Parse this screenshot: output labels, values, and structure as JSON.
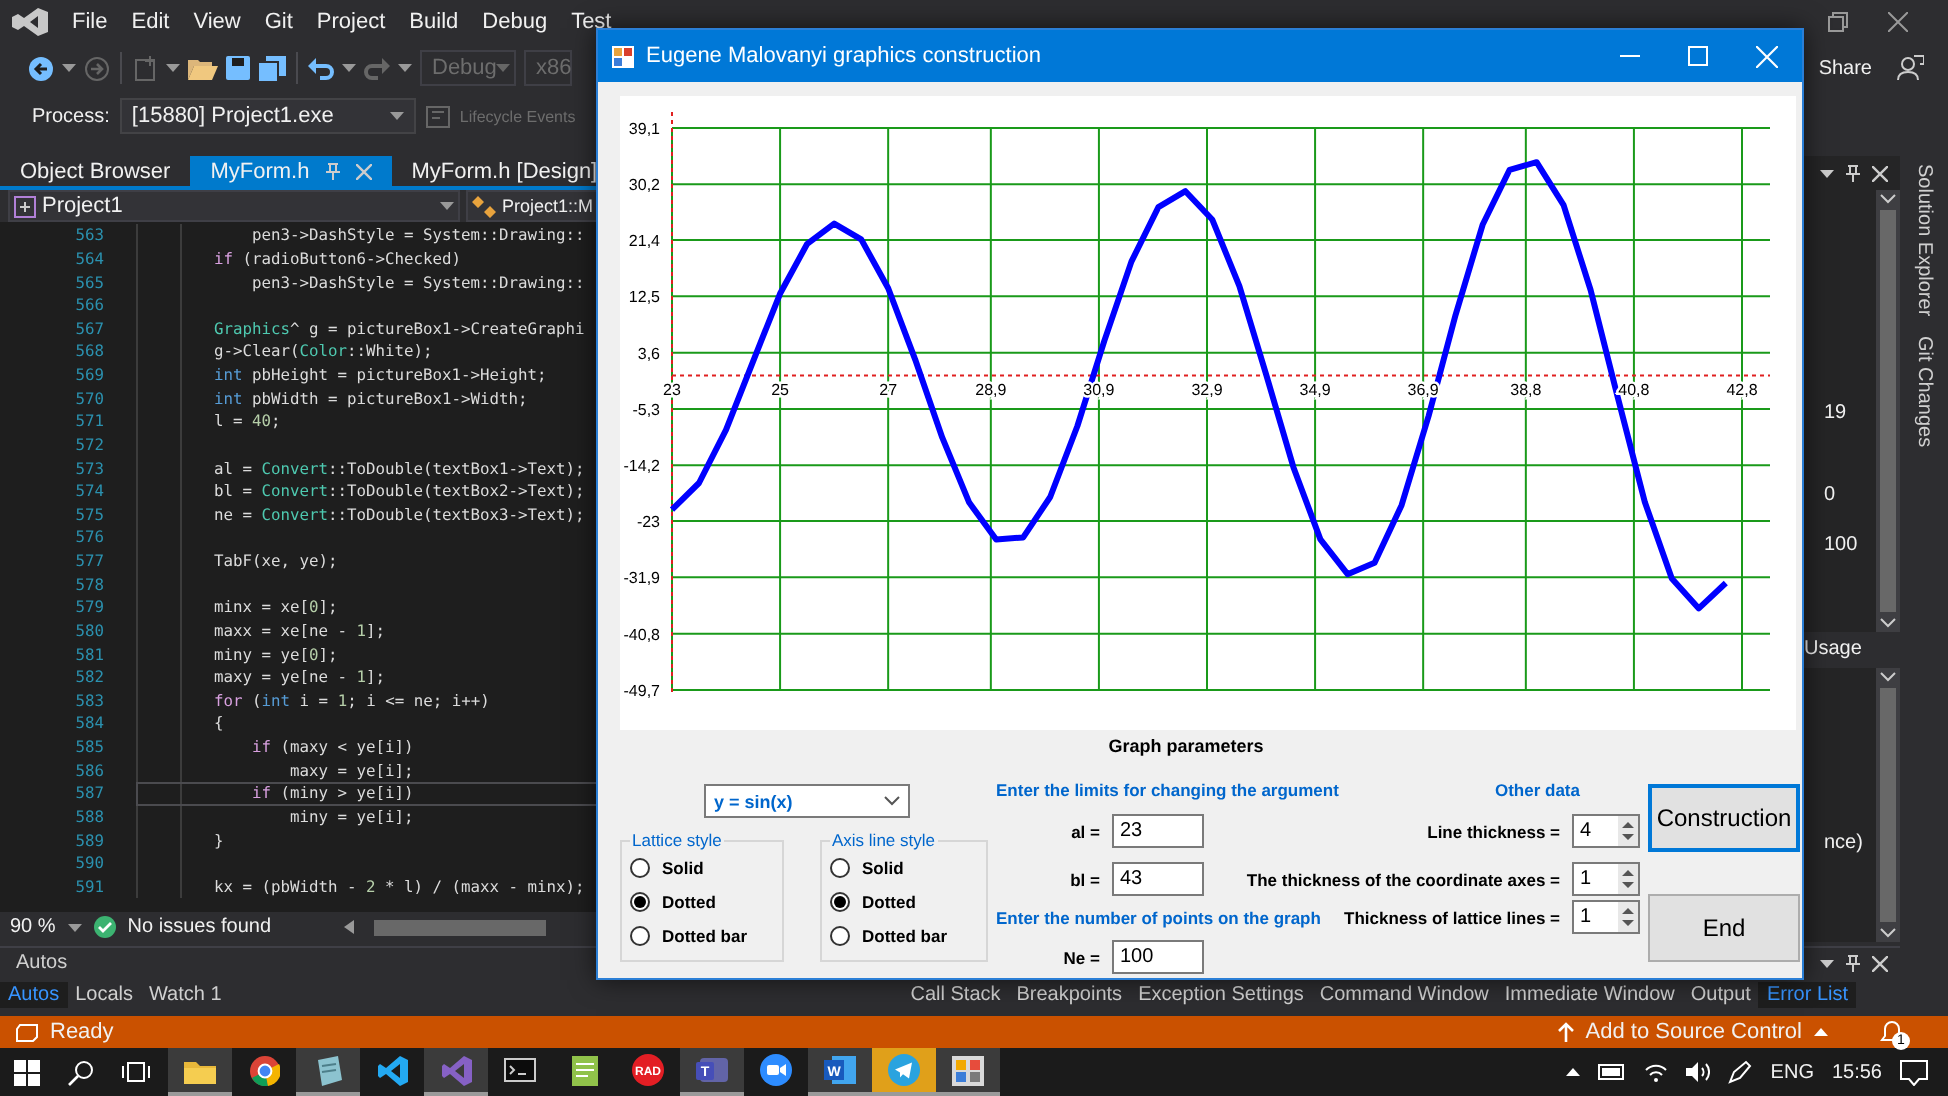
{
  "ide": {
    "menu": [
      "File",
      "Edit",
      "View",
      "Git",
      "Project",
      "Build",
      "Debug",
      "Test"
    ],
    "toolbar": {
      "configuration": "Debug",
      "platform": "x86",
      "share": "Share"
    },
    "process": {
      "label": "Process:",
      "value": "[15880] Project1.exe",
      "events": "Lifecycle Events"
    },
    "tabs": [
      {
        "label": "Object Browser",
        "selected": false
      },
      {
        "label": "MyForm.h",
        "selected": true
      },
      {
        "label": "MyForm.h [Design]",
        "selected": false
      }
    ],
    "navigation": {
      "project": "Project1",
      "scope": "Project1::M"
    },
    "editor": {
      "lines": [
        {
          "number": "563",
          "current": false,
          "code": [
            {
              "kind": "plain",
              "text": "    pen3->DashStyle = System::Drawing::"
            }
          ]
        },
        {
          "number": "564",
          "current": false,
          "code": [
            {
              "kind": "keyword",
              "text": "if"
            },
            {
              "kind": "plain",
              "text": " (radioButton6->Checked)"
            }
          ]
        },
        {
          "number": "565",
          "current": false,
          "code": [
            {
              "kind": "plain",
              "text": "    pen3->DashStyle = System::Drawing::"
            }
          ]
        },
        {
          "number": "566",
          "current": false
        },
        {
          "number": "567",
          "current": false,
          "code": [
            {
              "kind": "class",
              "text": "Graphics"
            },
            {
              "kind": "plain",
              "text": "^ g = pictureBox1->CreateGraphi"
            }
          ]
        },
        {
          "number": "568",
          "current": false,
          "code": [
            {
              "kind": "plain",
              "text": "g->Clear("
            },
            {
              "kind": "class",
              "text": "Color"
            },
            {
              "kind": "plain",
              "text": "::White);"
            }
          ]
        },
        {
          "number": "569",
          "current": false,
          "code": [
            {
              "kind": "type",
              "text": "int"
            },
            {
              "kind": "plain",
              "text": " pbHeight = pictureBox1->Height;"
            }
          ]
        },
        {
          "number": "570",
          "current": false,
          "code": [
            {
              "kind": "type",
              "text": "int"
            },
            {
              "kind": "plain",
              "text": " pbWidth = pictureBox1->Width;"
            }
          ]
        },
        {
          "number": "571",
          "current": false,
          "code": [
            {
              "kind": "plain",
              "text": "l = "
            },
            {
              "kind": "number",
              "text": "40"
            },
            {
              "kind": "plain",
              "text": ";"
            }
          ]
        },
        {
          "number": "572",
          "current": false
        },
        {
          "number": "573",
          "current": false,
          "code": [
            {
              "kind": "plain",
              "text": "al = "
            },
            {
              "kind": "class",
              "text": "Convert"
            },
            {
              "kind": "plain",
              "text": "::ToDouble(textBox1->Text);"
            }
          ]
        },
        {
          "number": "574",
          "current": false,
          "code": [
            {
              "kind": "plain",
              "text": "bl = "
            },
            {
              "kind": "class",
              "text": "Convert"
            },
            {
              "kind": "plain",
              "text": "::ToDouble(textBox2->Text);"
            }
          ]
        },
        {
          "number": "575",
          "current": false,
          "code": [
            {
              "kind": "plain",
              "text": "ne = "
            },
            {
              "kind": "class",
              "text": "Convert"
            },
            {
              "kind": "plain",
              "text": "::ToDouble(textBox3->Text);"
            }
          ]
        },
        {
          "number": "576",
          "current": false
        },
        {
          "number": "577",
          "current": false,
          "code": [
            {
              "kind": "plain",
              "text": "TabF(xe, ye);"
            }
          ]
        },
        {
          "number": "578",
          "current": false
        },
        {
          "number": "579",
          "current": false,
          "code": [
            {
              "kind": "plain",
              "text": "minx = xe["
            },
            {
              "kind": "number",
              "text": "0"
            },
            {
              "kind": "plain",
              "text": "];"
            }
          ]
        },
        {
          "number": "580",
          "current": false,
          "code": [
            {
              "kind": "plain",
              "text": "maxx = xe[ne - "
            },
            {
              "kind": "number",
              "text": "1"
            },
            {
              "kind": "plain",
              "text": "];"
            }
          ]
        },
        {
          "number": "581",
          "current": false,
          "code": [
            {
              "kind": "plain",
              "text": "miny = ye["
            },
            {
              "kind": "number",
              "text": "0"
            },
            {
              "kind": "plain",
              "text": "];"
            }
          ]
        },
        {
          "number": "582",
          "current": false,
          "code": [
            {
              "kind": "plain",
              "text": "maxy = ye[ne - "
            },
            {
              "kind": "number",
              "text": "1"
            },
            {
              "kind": "plain",
              "text": "];"
            }
          ]
        },
        {
          "number": "583",
          "current": false,
          "code": [
            {
              "kind": "keyword",
              "text": "for"
            },
            {
              "kind": "plain",
              "text": " ("
            },
            {
              "kind": "type",
              "text": "int"
            },
            {
              "kind": "plain",
              "text": " i = "
            },
            {
              "kind": "number",
              "text": "1"
            },
            {
              "kind": "plain",
              "text": "; i <= ne; i++)"
            }
          ]
        },
        {
          "number": "584",
          "current": false,
          "code": [
            {
              "kind": "plain",
              "text": "{"
            }
          ]
        },
        {
          "number": "585",
          "current": false,
          "code": [
            {
              "kind": "keyword",
              "text": "    if"
            },
            {
              "kind": "plain",
              "text": " (maxy < ye[i])"
            }
          ]
        },
        {
          "number": "586",
          "current": false,
          "code": [
            {
              "kind": "plain",
              "text": "        maxy = ye[i];"
            }
          ]
        },
        {
          "number": "587",
          "current": true,
          "code": [
            {
              "kind": "keyword",
              "text": "    if"
            },
            {
              "kind": "plain",
              "text": " (miny > ye[i])"
            }
          ]
        },
        {
          "number": "588",
          "current": false,
          "code": [
            {
              "kind": "plain",
              "text": "        miny = ye[i];"
            }
          ]
        },
        {
          "number": "589",
          "current": false,
          "code": [
            {
              "kind": "plain",
              "text": "}"
            }
          ]
        },
        {
          "number": "590",
          "current": false
        },
        {
          "number": "591",
          "current": false,
          "code": [
            {
              "kind": "plain",
              "text": "kx = (pbWidth - "
            },
            {
              "kind": "number",
              "text": "2"
            },
            {
              "kind": "plain",
              "text": " * l) / (maxx - minx);"
            }
          ]
        }
      ],
      "zoom": "90 %",
      "issues": "No issues found"
    },
    "diagnostics": {
      "values": [
        "19",
        "0",
        "100"
      ],
      "section": "Usage",
      "detail": "nce)"
    },
    "side_tabs": [
      "Solution Explorer",
      "Git Changes"
    ],
    "bottom_panel": {
      "title": "Autos",
      "left_tabs": [
        {
          "label": "Autos",
          "selected": true
        },
        {
          "label": "Locals",
          "selected": false
        },
        {
          "label": "Watch 1",
          "selected": false
        }
      ],
      "right_tabs": [
        {
          "label": "Call Stack",
          "selected": false
        },
        {
          "label": "Breakpoints",
          "selected": false
        },
        {
          "label": "Exception Settings",
          "selected": false
        },
        {
          "label": "Command Window",
          "selected": false
        },
        {
          "label": "Immediate Window",
          "selected": false
        },
        {
          "label": "Output",
          "selected": false
        },
        {
          "label": "Error List",
          "selected": true
        }
      ]
    },
    "status_bar": {
      "text": "Ready",
      "source_control": "Add to Source Control",
      "notifications": "1"
    }
  },
  "dialog": {
    "title": "Eugene Malovanyi graphics construction",
    "chart": {
      "chart_data": {
        "type": "line",
        "x": [
          23,
          23.5,
          24,
          24.5,
          25,
          25.5,
          26,
          26.5,
          27,
          27.5,
          28,
          28.5,
          29,
          29.5,
          30,
          30.5,
          31,
          31.5,
          32,
          32.5,
          33,
          33.5,
          34,
          34.5,
          35,
          35.5,
          36,
          36.5,
          37,
          37.5,
          38,
          38.5,
          39,
          39.5,
          40,
          40.5,
          41,
          41.5,
          42,
          42.5
        ],
        "series": [
          {
            "color": "#0000ff",
            "values": [
              -21.2,
              -17.0,
              -8.6,
              2.2,
              12.9,
              20.8,
              24.0,
              21.5,
              13.8,
              2.5,
              -9.8,
              -20.1,
              -25.9,
              -25.6,
              -19.2,
              -8.0,
              5.5,
              18.0,
              26.6,
              29.1,
              24.6,
              14.1,
              0.0,
              -14.5,
              -25.9,
              -31.4,
              -29.6,
              -20.5,
              -6.4,
              9.6,
              23.8,
              32.5,
              33.7,
              26.9,
              13.5,
              -3.5,
              -20.0,
              -32.1,
              -36.8,
              -32.8
            ]
          }
        ],
        "xlim": [
          23,
          42.8
        ],
        "ylim": [
          -49.7,
          39.1
        ],
        "grid": true,
        "ref_lines": [
          {
            "axis": "y",
            "value": 0,
            "color": "#e02020"
          },
          {
            "axis": "x",
            "value": 23,
            "color": "#e02020"
          }
        ],
        "xticks": [
          {
            "value": 23,
            "label": "23"
          },
          {
            "value": 25,
            "label": "25"
          },
          {
            "value": 27,
            "label": "27"
          },
          {
            "value": 28.9,
            "label": "28,9"
          },
          {
            "value": 30.9,
            "label": "30,9"
          },
          {
            "value": 32.9,
            "label": "32,9"
          },
          {
            "value": 34.9,
            "label": "34,9"
          },
          {
            "value": 36.9,
            "label": "36,9"
          },
          {
            "value": 38.8,
            "label": "38,8"
          },
          {
            "value": 40.8,
            "label": "40,8"
          },
          {
            "value": 42.8,
            "label": "42,8"
          }
        ],
        "yticks": [
          {
            "value": 39.1,
            "label": "39,1"
          },
          {
            "value": 30.2,
            "label": "30,2"
          },
          {
            "value": 21.4,
            "label": "21,4"
          },
          {
            "value": 12.5,
            "label": "12,5"
          },
          {
            "value": 3.6,
            "label": "3,6"
          },
          {
            "value": -5.3,
            "label": "-5,3"
          },
          {
            "value": -14.2,
            "label": "-14,2"
          },
          {
            "value": -23,
            "label": "-23"
          },
          {
            "value": -31.9,
            "label": "-31,9"
          },
          {
            "value": -40.8,
            "label": "-40,8"
          },
          {
            "value": -49.7,
            "label": "-49,7"
          }
        ]
      }
    },
    "parameters_title": "Graph parameters",
    "function": {
      "value": "y = sin(x)"
    },
    "groups": [
      {
        "title": "Lattice style",
        "options": [
          {
            "label": "Solid",
            "selected": false
          },
          {
            "label": "Dotted",
            "selected": true
          },
          {
            "label": "Dotted bar",
            "selected": false
          }
        ]
      },
      {
        "title": "Axis line style",
        "options": [
          {
            "label": "Solid",
            "selected": false
          },
          {
            "label": "Dotted",
            "selected": true
          },
          {
            "label": "Dotted bar",
            "selected": false
          }
        ]
      }
    ],
    "limits": {
      "title": "Enter the limits for changing the argument",
      "fields": [
        {
          "label": "al =",
          "value": "23"
        },
        {
          "label": "bl =",
          "value": "43"
        }
      ]
    },
    "points": {
      "title": "Enter the number of points on the graph",
      "label": "Ne =",
      "value": "100"
    },
    "other": {
      "title": "Other data",
      "spinners": [
        {
          "label": "Line thickness =",
          "value": "4"
        },
        {
          "label": "The thickness of the coordinate axes =",
          "value": "1"
        },
        {
          "label": "Thickness of lattice lines =",
          "value": "1"
        }
      ]
    },
    "buttons": [
      {
        "label": "Construction",
        "focused": true
      },
      {
        "label": "End",
        "focused": false
      }
    ]
  },
  "taskbar": {
    "apps": [
      {
        "kind": "folder",
        "running": true,
        "flashing": false
      },
      {
        "kind": "browser",
        "running": false,
        "flashing": false
      },
      {
        "kind": "notes",
        "running": true,
        "flashing": false
      },
      {
        "kind": "editor-blue",
        "running": false,
        "flashing": false
      },
      {
        "kind": "editor-purple",
        "running": true,
        "flashing": false
      },
      {
        "kind": "terminal",
        "running": false,
        "flashing": false
      },
      {
        "kind": "notepad",
        "running": false,
        "flashing": false
      },
      {
        "kind": "rad",
        "running": false,
        "flashing": false,
        "label": "RAD"
      },
      {
        "kind": "chat",
        "running": true,
        "flashing": false,
        "label": "T"
      },
      {
        "kind": "video",
        "running": false,
        "flashing": false
      },
      {
        "kind": "document",
        "running": true,
        "flashing": false,
        "label": "W"
      },
      {
        "kind": "messenger",
        "running": true,
        "flashing": true
      },
      {
        "kind": "chart-app",
        "running": true,
        "flashing": false
      }
    ],
    "language": "ENG",
    "time": "15:56"
  }
}
